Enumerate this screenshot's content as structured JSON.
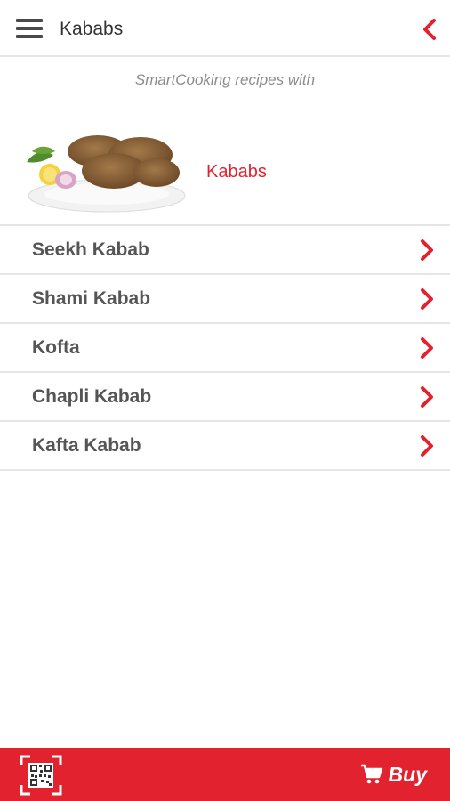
{
  "appbar": {
    "title": "Kababs",
    "menu_icon": "hamburger-menu-icon",
    "back_icon": "chevron-left-icon"
  },
  "tagline": "SmartCooking recipes with",
  "hero": {
    "label": "Kababs",
    "image": "kababs-dish-image"
  },
  "recipes": [
    {
      "label": "Seekh Kabab"
    },
    {
      "label": "Shami Kabab"
    },
    {
      "label": "Kofta"
    },
    {
      "label": "Chapli Kabab"
    },
    {
      "label": "Kafta Kabab"
    }
  ],
  "bottombar": {
    "buy_label": "Buy",
    "qr_icon": "qr-code-icon",
    "cart_icon": "cart-icon"
  },
  "colors": {
    "accent": "#e2222e",
    "text_dark": "#555555",
    "divider": "#e6e6e6"
  }
}
